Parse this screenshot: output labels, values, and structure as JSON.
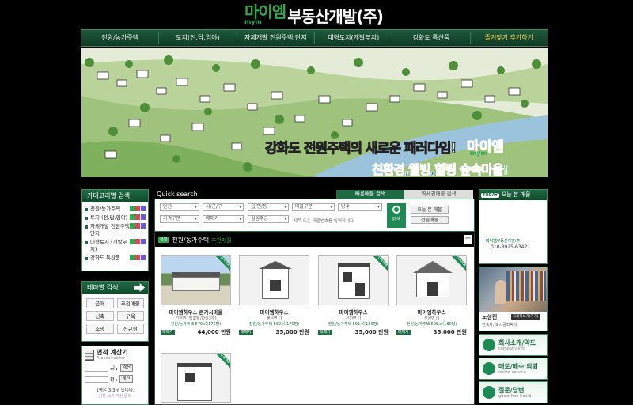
{
  "header": {
    "brand": "마이엠",
    "brand_sub": "mym",
    "company": "부동산개발(주)"
  },
  "nav": {
    "items": [
      {
        "label": "전원/농가주택"
      },
      {
        "label": "토지(전,답,임야)"
      },
      {
        "label": "자체개발 전원주택 단지"
      },
      {
        "label": "대형토지(개발부지)"
      },
      {
        "label": "강화도 특산품"
      },
      {
        "label": "즐겨찾기 추가하기"
      }
    ]
  },
  "banner": {
    "slogan1": "강화도 전원주택의 새로운 패러다임!",
    "slogan_brand": "마이엠",
    "slogan_brand_sub": "mym",
    "slogan2": "친환경,웰빙,힐링",
    "slogan2_tail": "숲속마을!"
  },
  "category_search": {
    "title": "카테고리별 검색",
    "items": [
      {
        "label": "전원/농가주택"
      },
      {
        "label": "토지 (전,답,임야)"
      },
      {
        "label": "자체개발 전원주택단지"
      },
      {
        "label": "대형토지 (개발부지)"
      },
      {
        "label": "강화도 특산품"
      }
    ],
    "tag_colors": [
      "#2fa84f",
      "#e04848",
      "#6a5acd"
    ]
  },
  "theme_search": {
    "title": "테마별 검색",
    "buttons": [
      "급매",
      "추천매물",
      "신축",
      "구옥",
      "조망",
      "신규원"
    ]
  },
  "calculator": {
    "title": "면적 계산기",
    "subtitle": "Areacalculator",
    "unit_m2": "㎡ ▸",
    "unit_py": "평 ▸",
    "btn": "계산",
    "note": "1평은 3.3㎡ 입니다.",
    "note2": "간편 요기 계산 클릭"
  },
  "quick_search": {
    "title": "Quick search",
    "tab_active": "빠른매물 검색",
    "tab_inactive": "역세권매물 검색",
    "selects_row1": [
      "인천",
      "시/군/구",
      "읍/면/동",
      "매물구분",
      "방수"
    ],
    "selects_row2": [
      "가격구분",
      "매매가",
      "실입주금"
    ],
    "hint": "제목 또는 매물번호를 입력하세요",
    "search_btn": "검색",
    "btn_today": "오늘 본 매물",
    "btn_recommend": "전원매물"
  },
  "listing": {
    "badge": "전원",
    "title": "전원/농가주택",
    "title_suffix": "추천매물",
    "more": "+",
    "cards": [
      {
        "ribbon": "신축매물",
        "name": "마이엠하우스 콘가시마을",
        "sub": "선원면 [방3개 /화실3개]",
        "info": "전원/농가주택 579㎡(175평)",
        "sale": "매매가",
        "price": "44,000 만원"
      },
      {
        "ribbon": "",
        "name": "마이엠하우스",
        "sub": "불은면 []",
        "info": "전원/농가주택 562㎡(170평)",
        "sale": "매매가",
        "price": "35,000 만원"
      },
      {
        "ribbon": "신축매물",
        "name": "마이엠하우스",
        "sub": "선원면 []",
        "info": "전원/농가주택 595㎡(180평)",
        "sale": "매매가",
        "price": "35,000 만원"
      },
      {
        "ribbon": "신축매물",
        "name": "마이엠하우스",
        "sub": "선원면 []",
        "info": "전원/농가주택 595㎡(180평)",
        "sale": "매매가",
        "price": "35,000 만원"
      },
      {
        "ribbon": "신축매물",
        "name": "",
        "sub": "",
        "info": "",
        "sale": "",
        "price": ""
      }
    ]
  },
  "today": {
    "tag": "TODAY",
    "title": "오늘 본 매물",
    "company_brand": "마이엠",
    "company": "부동산개발(주)",
    "tel": "010-8925-6342"
  },
  "agent": {
    "name": "노성진",
    "profile_btn": "자세히보기(가기)",
    "role": "건축가, 도시공학박사"
  },
  "right_buttons": [
    {
      "main": "회사소개/약도",
      "sub": "company info"
    },
    {
      "main": "매도/매수 의뢰",
      "sub": "online service"
    },
    {
      "main": "질문/답변",
      "sub": "guest free board"
    }
  ]
}
